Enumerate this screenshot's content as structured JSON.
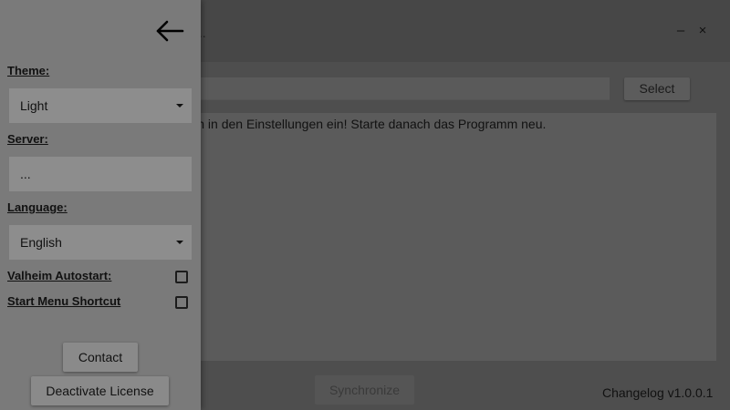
{
  "window": {
    "title_fragment": "...",
    "minimize_glyph": "–",
    "close_glyph": "×"
  },
  "main": {
    "path_value": "",
    "select_label": "Select",
    "log_text": "Bitte trage den Pfad zu deinem Plugin in den Einstellungen ein! Starte danach das Programm neu.",
    "synchronize_label": "Synchronize",
    "changelog_label": "Changelog v1.0.0.1"
  },
  "settings": {
    "back_icon": "arrow-left-icon",
    "theme_label": "Theme:",
    "theme_value": "Light",
    "server_label": "Server:",
    "server_value": "...",
    "language_label": "Language:",
    "language_value": "English",
    "autostart_label": "Valheim Autostart:",
    "autostart_checked": false,
    "shortcut_label": "Start Menu Shortcut",
    "shortcut_checked": false,
    "contact_label": "Contact",
    "deactivate_label": "Deactivate License"
  }
}
